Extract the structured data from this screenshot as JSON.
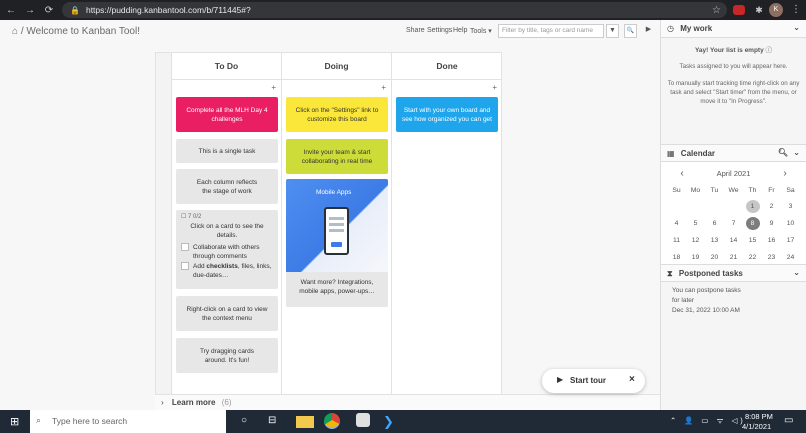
{
  "browser": {
    "url": "https://pudding.kanbantool.com/b/711445#?",
    "avatar_initial": "K"
  },
  "topbar": {
    "breadcrumb_home": "⌂",
    "breadcrumb": "/ Welcome to Kanban Tool!",
    "menu": [
      "Share",
      "Settings",
      "Help",
      "Tools ▾"
    ],
    "search_placeholder": "Filter by title, tags or card name",
    "filter_btn": "▼",
    "search_btn": "🔍",
    "toggle_btn": "▶"
  },
  "columns": [
    {
      "name": "To Do"
    },
    {
      "name": "Doing"
    },
    {
      "name": "Done"
    }
  ],
  "cards": {
    "todo": [
      {
        "text": "Complete all the MLH Day 4 challenges",
        "color": "#e91e63"
      },
      {
        "text": "This is a single task",
        "color": "#e4e4e4"
      },
      {
        "text": "Each column reflects the stage of work",
        "color": "#e4e4e4"
      },
      {
        "meta": "☐ 7  0/2",
        "text": "Click on a card to see the details.",
        "check1": "Collaborate with others through comments",
        "check2_pre": "Add",
        "check2_bold": "checklists",
        "check2_post": ", files, links, due-dates…",
        "color": "#e4e4e4"
      },
      {
        "text": "Right-click on a card to view the context menu",
        "color": "#e4e4e4"
      },
      {
        "text": "Try dragging cards around. It's fun!",
        "color": "#e4e4e4"
      }
    ],
    "doing": [
      {
        "text": "Click on the \"Settings\" link to customize this board",
        "color": "#fbe63a"
      },
      {
        "text": "Invite your team & start collaborating in real time",
        "color": "#cddc39"
      },
      {
        "image_title": "Mobile Apps",
        "text": "Want more? Integrations, mobile apps, power-ups…",
        "color": "#e4e4e4"
      }
    ],
    "done": [
      {
        "text": "Start with your own board and see how organized you can get",
        "color": "#1ea5ec"
      }
    ]
  },
  "learn_more": {
    "label": "Learn more",
    "count": "(6)"
  },
  "my_work": {
    "title": "My work",
    "empty": "Yay! Your list is empty",
    "desc1": "Tasks assigned to you will appear here.",
    "desc2": "To manually start tracking time right-click on any task and select \"Start timer\" from the menu, or move it to \"In Progress\"."
  },
  "calendar": {
    "title": "Calendar",
    "month": "April 2021",
    "weekdays": [
      "Su",
      "Mo",
      "Tu",
      "We",
      "Th",
      "Fr",
      "Sa"
    ],
    "weeks": [
      [
        "",
        "",
        "",
        "",
        "1",
        "2",
        "3"
      ],
      [
        "4",
        "5",
        "6",
        "7",
        "8",
        "9",
        "10"
      ],
      [
        "11",
        "12",
        "13",
        "14",
        "15",
        "16",
        "17"
      ],
      [
        "18",
        "19",
        "20",
        "21",
        "22",
        "23",
        "24"
      ],
      [
        "25",
        "26",
        "27",
        "28",
        "29",
        "30",
        ""
      ]
    ],
    "selected": "1",
    "today": "8"
  },
  "postponed": {
    "title": "Postponed tasks",
    "text1": "You can postpone tasks",
    "text2": "for later",
    "date": "Dec 31, 2022 10:00 AM"
  },
  "tour": {
    "label": "Start tour",
    "close": "×"
  },
  "taskbar": {
    "search": "Type here to search",
    "time": "8:08 PM",
    "date": "4/1/2021"
  }
}
